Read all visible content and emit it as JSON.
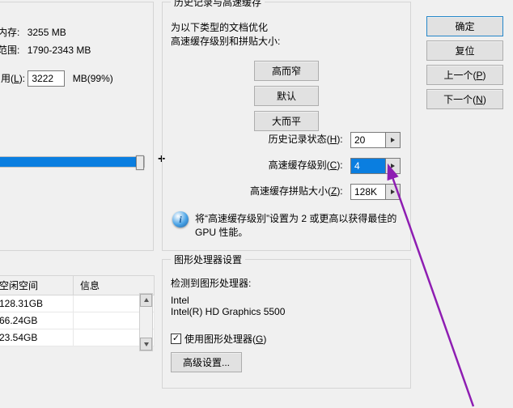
{
  "left": {
    "mem_label": "内存:",
    "mem_value": "3255 MB",
    "range_label": "范围:",
    "range_value": "1790-2343 MB",
    "use_label_prefix": "用(",
    "use_hotkey": "L",
    "use_label_suffix": "):",
    "use_value": "3222",
    "use_unit": "MB(99%)",
    "plus": "+"
  },
  "cache": {
    "title": "历史记录与高速缓存",
    "line1": "为以下类型的文档优化",
    "line2": "高速缓存级别和拼贴大小:",
    "btn_tall": "高而窄",
    "btn_default": "默认",
    "btn_flat": "大而平",
    "history_label_prefix": "历史记录状态(",
    "history_hotkey": "H",
    "history_label_suffix": "):",
    "history_value": "20",
    "level_label_prefix": "高速缓存级别(",
    "level_hotkey": "C",
    "level_label_suffix": "):",
    "level_value": "4",
    "tile_label_prefix": "高速缓存拼贴大小(",
    "tile_hotkey": "Z",
    "tile_label_suffix": "):",
    "tile_value": "128K",
    "info_text": "将“高速缓存级别”设置为 2 或更高以获得最佳的 GPU 性能。"
  },
  "drives": {
    "col_free": "空闲空间",
    "col_info": "信息",
    "rows": [
      "128.31GB",
      "66.24GB",
      "23.54GB"
    ]
  },
  "gpu": {
    "title": "图形处理器设置",
    "detect_label": "检测到图形处理器:",
    "vendor": "Intel",
    "model": "Intel(R) HD Graphics 5500",
    "use_gpu_prefix": "使用图形处理器(",
    "use_gpu_hotkey": "G",
    "use_gpu_suffix": ")",
    "advanced": "高级设置..."
  },
  "right": {
    "ok": "确定",
    "reset": "复位",
    "prev_prefix": "上一个(",
    "prev_hotkey": "P",
    "prev_suffix": ")",
    "next_prefix": "下一个(",
    "next_hotkey": "N",
    "next_suffix": ")"
  }
}
